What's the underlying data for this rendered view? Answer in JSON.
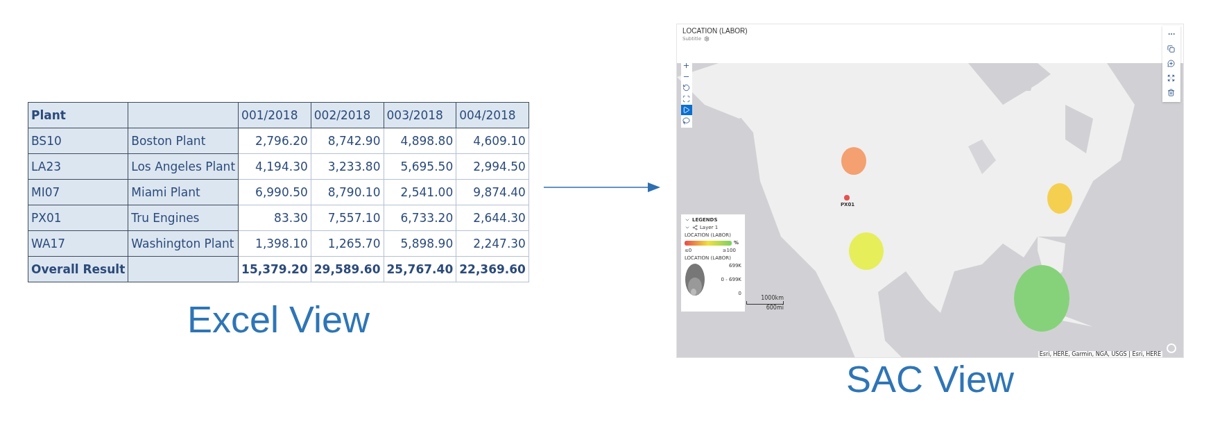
{
  "excel_view": {
    "plant_header": "Plant",
    "periods": [
      "001/2018",
      "002/2018",
      "003/2018",
      "004/2018"
    ],
    "rows": [
      {
        "code": "BS10",
        "name": "Boston Plant",
        "values": [
          "2,796.20",
          "8,742.90",
          "4,898.80",
          "4,609.10"
        ]
      },
      {
        "code": "LA23",
        "name": "Los Angeles Plant",
        "values": [
          "4,194.30",
          "3,233.80",
          "5,695.50",
          "2,994.50"
        ]
      },
      {
        "code": "MI07",
        "name": "Miami Plant",
        "values": [
          "6,990.50",
          "8,790.10",
          "2,541.00",
          "9,874.40"
        ]
      },
      {
        "code": "PX01",
        "name": "Tru Engines",
        "values": [
          "83.30",
          "7,557.10",
          "6,733.20",
          "2,644.30"
        ]
      },
      {
        "code": "WA17",
        "name": "Washington Plant",
        "values": [
          "1,398.10",
          "1,265.70",
          "5,898.90",
          "2,247.30"
        ]
      }
    ],
    "total": {
      "label": "Overall Result",
      "values": [
        "15,379.20",
        "29,589.60",
        "25,767.40",
        "22,369.60"
      ]
    },
    "caption": "Excel View"
  },
  "sac_view": {
    "title": "LOCATION (LABOR)",
    "subtitle": "Subtitle",
    "map_tools": [
      {
        "kind": "zoom-in",
        "selected": false
      },
      {
        "kind": "zoom-out",
        "selected": false
      },
      {
        "kind": "reset",
        "selected": false
      },
      {
        "kind": "extent",
        "selected": false
      },
      {
        "kind": "pointer",
        "selected": true
      },
      {
        "kind": "lasso",
        "selected": false
      }
    ],
    "bubbles": [
      {
        "color": "#f4a070"
      },
      {
        "color": "#e85050",
        "label": "PX01"
      },
      {
        "color": "#f5d050"
      },
      {
        "color": "#e6ee5a"
      },
      {
        "color": "#86d27a"
      }
    ],
    "legend": {
      "title": "LEGENDS",
      "layer": "Layer 1",
      "color_title": "LOCATION (LABOR)",
      "unit": "%",
      "min": "≤0",
      "max": "≥100",
      "size_title": "LOCATION (LABOR)",
      "size_labels": [
        "699K",
        "0 - 699K",
        "0"
      ]
    },
    "scale": {
      "km": "1000km",
      "mi": "600mi"
    },
    "attribution": "Esri, HERE, Garmin, NGA, USGS | Esri, HERE",
    "caption": "SAC View"
  }
}
